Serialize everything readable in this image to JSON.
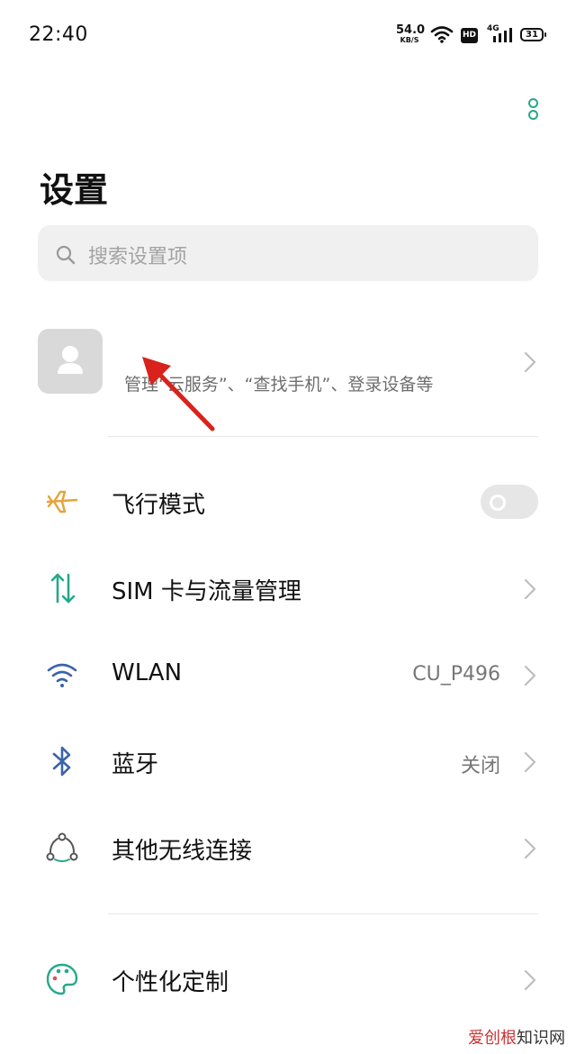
{
  "status_bar": {
    "time": "22:40",
    "net_speed_value": "54.0",
    "net_speed_unit": "KB/S",
    "hd_badge": "HD",
    "network_type": "4G",
    "battery": "31"
  },
  "header": {
    "title": "设置"
  },
  "search": {
    "placeholder": "搜索设置项"
  },
  "account": {
    "subtitle": "管理“云服务”、“查找手机”、登录设备等"
  },
  "settings": [
    {
      "label": "飞行模式",
      "icon": "airplane-icon",
      "value": "",
      "control": "toggle",
      "toggle_on": false
    },
    {
      "label": "SIM 卡与流量管理",
      "icon": "sim-data-icon",
      "value": "",
      "control": "chevron"
    },
    {
      "label": "WLAN",
      "icon": "wifi-icon",
      "value": "CU_P496",
      "control": "chevron"
    },
    {
      "label": "蓝牙",
      "icon": "bluetooth-icon",
      "value": "关闭",
      "control": "chevron"
    },
    {
      "label": "其他无线连接",
      "icon": "wireless-connection-icon",
      "value": "",
      "control": "chevron"
    },
    {
      "label": "个性化定制",
      "icon": "palette-icon",
      "value": "",
      "control": "chevron"
    }
  ],
  "watermark": {
    "text_red": "爱创根",
    "text_dark": "知识网"
  },
  "colors": {
    "accent_green": "#27a88a",
    "annotation_red": "#d9221c",
    "airplane_orange": "#e6a33a",
    "wifi_blue": "#3a63a8"
  }
}
